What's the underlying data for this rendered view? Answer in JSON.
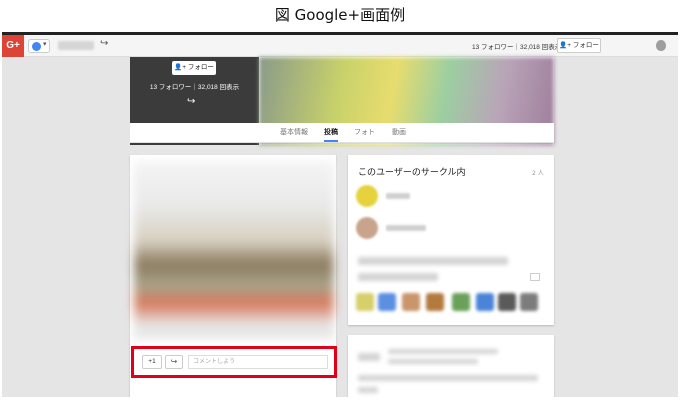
{
  "caption": "図 Google+画面例",
  "appbar": {
    "logo": "G+",
    "stats": "13 フォロワー｜32,018 回表示",
    "follow_label": "フォロー",
    "icons": [
      "gplus-logo",
      "user-icon",
      "share-icon",
      "add-person-icon",
      "notification-icon"
    ]
  },
  "profile": {
    "follow_label": "フォロー",
    "stats": "13 フォロワー｜32,018 回表示",
    "tabs": [
      {
        "label": "基本情報",
        "active": false
      },
      {
        "label": "投稿",
        "active": true
      },
      {
        "label": "フォト",
        "active": false
      },
      {
        "label": "動画",
        "active": false
      }
    ]
  },
  "post": {
    "plus_one": "+1",
    "share": "↪",
    "comment_placeholder": "コメントしよう"
  },
  "circles": {
    "title": "このユーザーのサークル内",
    "count": "2 人"
  },
  "colors": {
    "gplus_red": "#db4437",
    "highlight_red": "#e0001a",
    "tab_accent": "#4285f4"
  }
}
